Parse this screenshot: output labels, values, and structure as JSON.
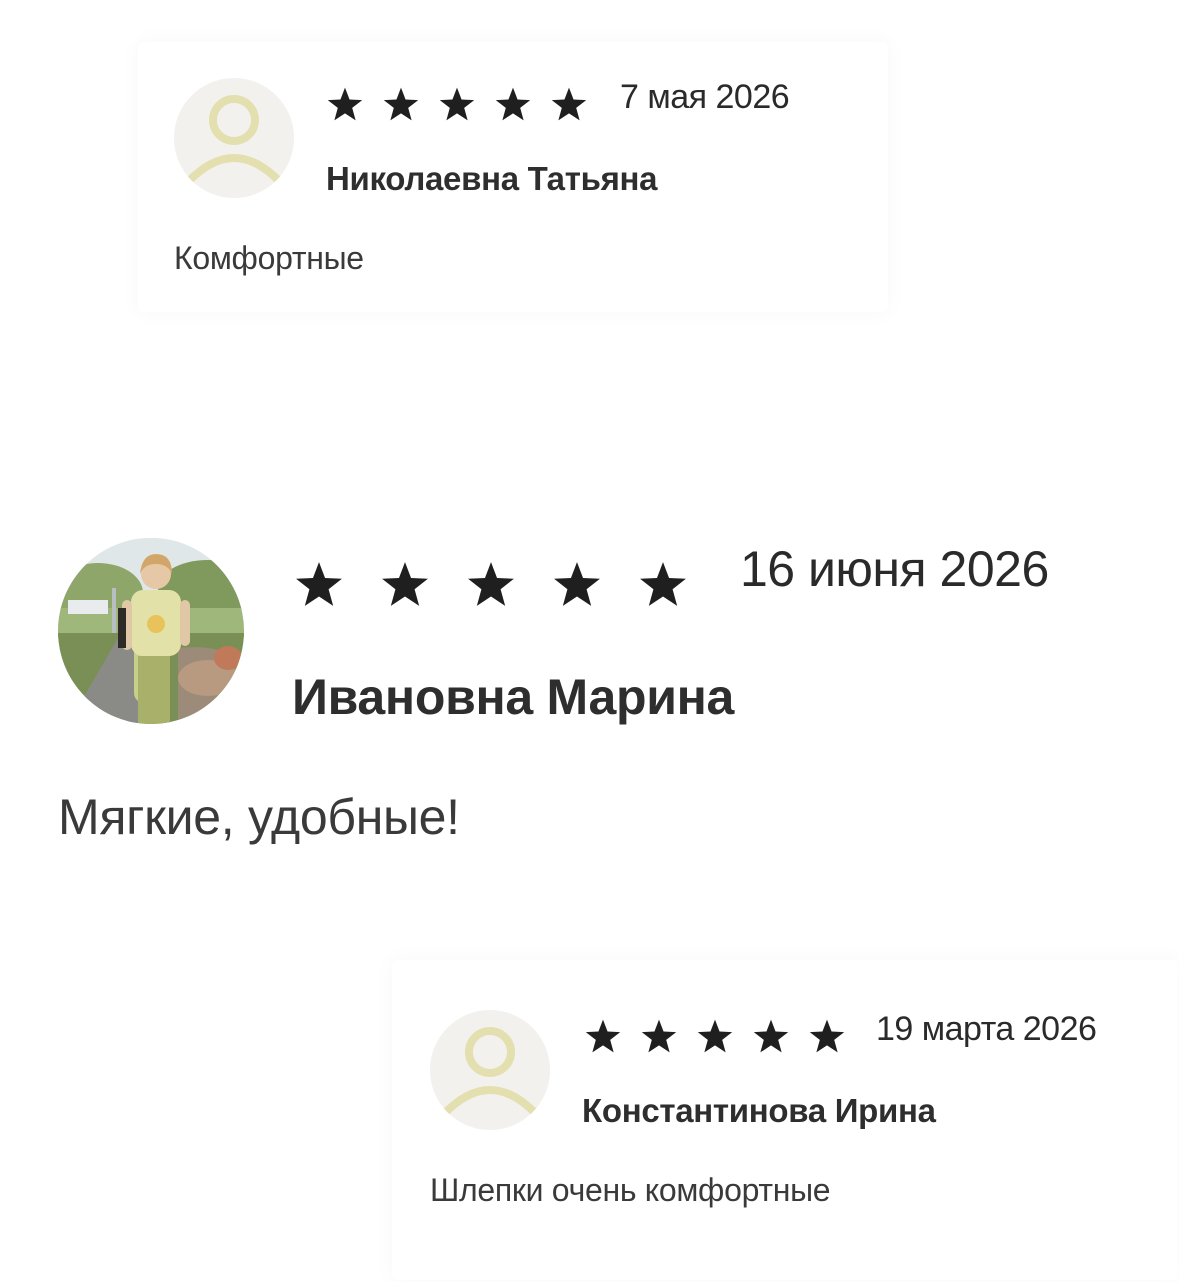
{
  "reviews": [
    {
      "rating": 5,
      "date": "7 мая 2026",
      "author": "Николаевна Татьяна",
      "text": "Комфортные",
      "avatar": "placeholder-user-icon"
    },
    {
      "rating": 5,
      "date": "16 июня 2026",
      "author": "Ивановна Марина",
      "text": "Мягкие, удобные!",
      "avatar": "user-photo"
    },
    {
      "rating": 5,
      "date": "19 марта 2026",
      "author": "Константинова Ирина",
      "text": "Шлепки очень комфортные",
      "avatar": "placeholder-user-icon"
    }
  ],
  "colors": {
    "star": "#1f1f1f",
    "placeholder_bg": "#f2f1ee",
    "placeholder_icon": "#e3dfae",
    "text": "#333333"
  }
}
